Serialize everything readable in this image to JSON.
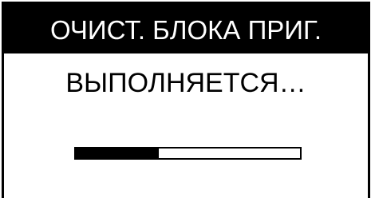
{
  "header": {
    "title": "ОЧИСТ. БЛОКА ПРИГ."
  },
  "status": {
    "message": "ВЫПОЛНЯЕТСЯ…"
  },
  "progress": {
    "fraction": 0.37
  },
  "colors": {
    "foreground": "#000000",
    "background": "#ffffff"
  }
}
